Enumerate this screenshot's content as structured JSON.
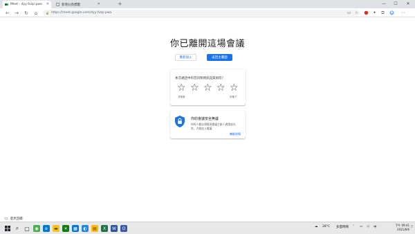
{
  "browser": {
    "tabs": [
      {
        "title": "Meet - dyy-fvzp-pwa",
        "active": true
      },
      {
        "title": "新增分頁標籤",
        "active": false
      }
    ],
    "new_tab_label": "+",
    "url": "https://meet.google.com/dyy-fvzp-pwa",
    "window_controls": {
      "minimize": "—",
      "maximize": "☐",
      "close": "✕"
    },
    "nav": {
      "back": "←",
      "forward": "→",
      "reload": "↻",
      "home": "⌂"
    }
  },
  "page": {
    "title": "你已離開這場會議",
    "rejoin_label": "重新加入",
    "home_label": "返回主畫面",
    "feedback": {
      "question": "本次通話中的音訊和視訊品質如何?",
      "star_glyph": "☆",
      "star_count": 5,
      "low_label": "非常差",
      "high_label": "好極了"
    },
    "security": {
      "title": "你的會議安全無虞",
      "description": "你的人都必須經過會議主辦人邀請或允許，才能加入會議",
      "link": "瞭解詳情"
    },
    "report_label": "意見回饋"
  },
  "taskbar": {
    "weather": "28°C",
    "weather_desc": "多雲時晴",
    "time": "下午 09:41",
    "date": "2021/8/6",
    "accent": "#1a73e8"
  }
}
